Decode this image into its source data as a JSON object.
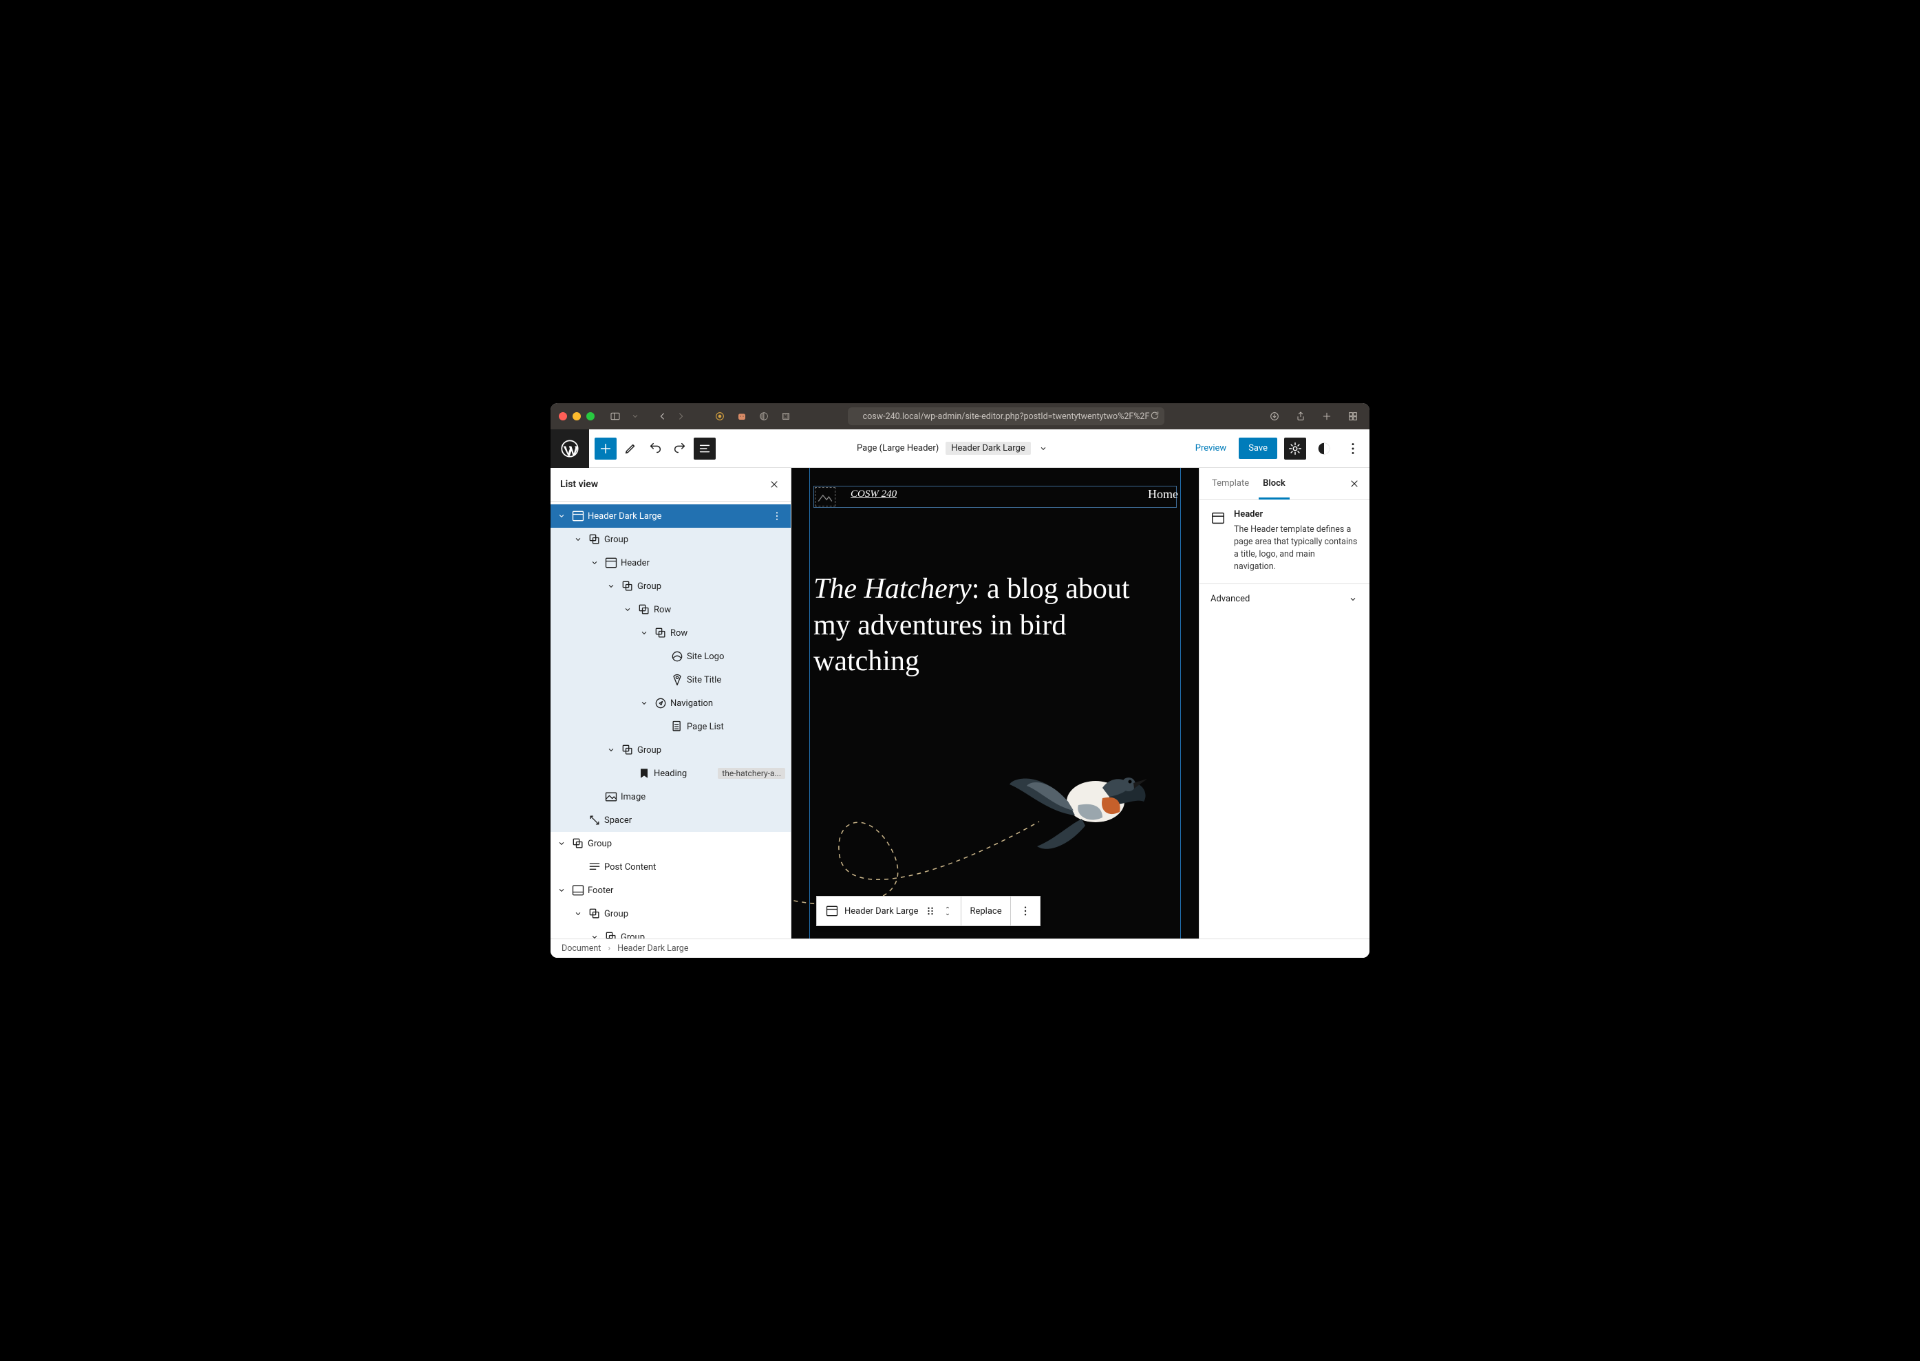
{
  "browser": {
    "url": "cosw-240.local/wp-admin/site-editor.php?postId=twentytwentytwo%2F%2F"
  },
  "editbar": {
    "template_name": "Page (Large Header)",
    "part_name": "Header Dark Large",
    "preview": "Preview",
    "save": "Save"
  },
  "listview": {
    "title": "List view",
    "nodes": [
      {
        "depth": 0,
        "caret": "down",
        "icon": "header",
        "label": "Header Dark Large",
        "sel": true,
        "opts": true
      },
      {
        "depth": 1,
        "caret": "down",
        "icon": "group",
        "label": "Group",
        "ancestor": true
      },
      {
        "depth": 2,
        "caret": "down",
        "icon": "header",
        "label": "Header",
        "ancestor": true
      },
      {
        "depth": 3,
        "caret": "down",
        "icon": "group",
        "label": "Group",
        "ancestor": true
      },
      {
        "depth": 4,
        "caret": "down",
        "icon": "row",
        "label": "Row",
        "ancestor": true
      },
      {
        "depth": 5,
        "caret": "down",
        "icon": "row",
        "label": "Row",
        "ancestor": true
      },
      {
        "depth": 6,
        "caret": "none",
        "icon": "sitelogo",
        "label": "Site Logo",
        "ancestor": true
      },
      {
        "depth": 6,
        "caret": "none",
        "icon": "sitetitle",
        "label": "Site Title",
        "ancestor": true
      },
      {
        "depth": 5,
        "caret": "down",
        "icon": "nav",
        "label": "Navigation",
        "ancestor": true
      },
      {
        "depth": 6,
        "caret": "none",
        "icon": "pagelist",
        "label": "Page List",
        "ancestor": true
      },
      {
        "depth": 3,
        "caret": "down",
        "icon": "group",
        "label": "Group",
        "ancestor": true
      },
      {
        "depth": 4,
        "caret": "none",
        "icon": "heading",
        "label": "Heading",
        "badge": "the-hatchery-a...",
        "ancestor": true
      },
      {
        "depth": 2,
        "caret": "none",
        "icon": "image",
        "label": "Image",
        "ancestor": true
      },
      {
        "depth": 1,
        "caret": "none",
        "icon": "spacer",
        "label": "Spacer",
        "ancestor": true
      },
      {
        "depth": 0,
        "caret": "down",
        "icon": "group",
        "label": "Group"
      },
      {
        "depth": 1,
        "caret": "none",
        "icon": "postcontent",
        "label": "Post Content"
      },
      {
        "depth": 0,
        "caret": "down",
        "icon": "footer",
        "label": "Footer"
      },
      {
        "depth": 1,
        "caret": "down",
        "icon": "group",
        "label": "Group"
      },
      {
        "depth": 2,
        "caret": "down",
        "icon": "group",
        "label": "Group"
      }
    ]
  },
  "canvas": {
    "site_title": "COSW 240",
    "nav_home": "Home",
    "hero_italic": "The Hatchery",
    "hero_rest": ": a blog about my adventures in bird watching"
  },
  "floatbar": {
    "label": "Header Dark Large",
    "replace": "Replace"
  },
  "inspector": {
    "tab_template": "Template",
    "tab_block": "Block",
    "block_title": "Header",
    "block_desc": "The Header template defines a page area that typically contains a title, logo, and main navigation.",
    "advanced": "Advanced"
  },
  "crumbs": {
    "a": "Document",
    "b": "Header Dark Large"
  }
}
